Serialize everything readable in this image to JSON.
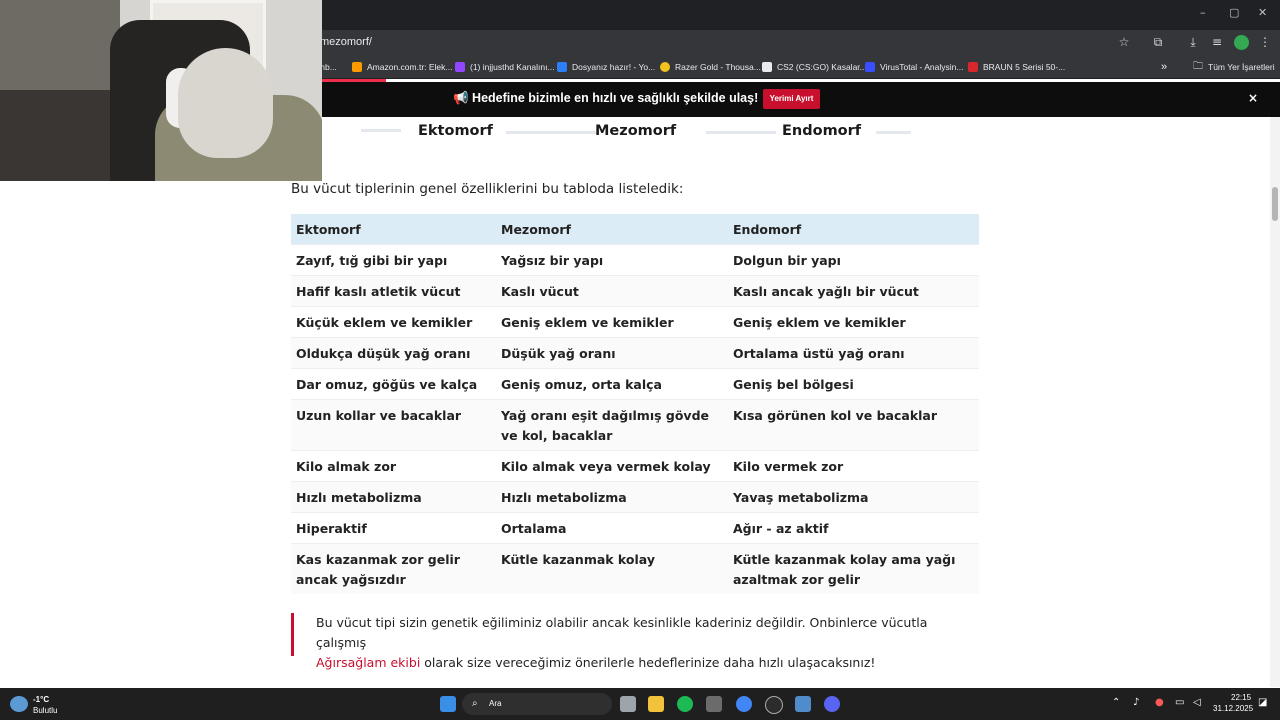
{
  "browser": {
    "url": "mezomorf/",
    "bookmarks": [
      {
        "label": "shb...",
        "color": "#f29900"
      },
      {
        "label": "Amazon.com.tr: Elek...",
        "color": "#ff9900"
      },
      {
        "label": "(1) injjusthd Kanalını...",
        "color": "#9146ff"
      },
      {
        "label": "Dosyanız hazır! - Yo...",
        "color": "#2d7ef7"
      },
      {
        "label": "Razer Gold - Thousa...",
        "color": "#f4c21b"
      },
      {
        "label": "CS2 (CS:GO) Kasalar...",
        "color": "#e8eaed"
      },
      {
        "label": "VirusTotal - Analysin...",
        "color": "#394eff"
      },
      {
        "label": "BRAUN 5 Serisi 50-...",
        "color": "#d7262c"
      }
    ],
    "all_bookmarks": "Tüm Yer İşaretleri",
    "more_bookmarks_icon": "»"
  },
  "banner": {
    "text": "📢 Hedefine bizimle en hızlı ve sağlıklı şekilde ulaş! 💪",
    "button": "Yerimi Ayırt",
    "close": "×"
  },
  "body_image": {
    "labels": [
      "Ektomorf",
      "Mezomorf",
      "Endomorf"
    ]
  },
  "article": {
    "intro": "Bu vücut tiplerinin genel özelliklerini bu tabloda listeledik:",
    "table": {
      "headers": [
        "Ektomorf",
        "Mezomorf",
        "Endomorf"
      ],
      "rows": [
        [
          "Zayıf, tığ gibi bir yapı",
          "Yağsız bir yapı",
          "Dolgun bir yapı"
        ],
        [
          "Hafif kaslı atletik vücut",
          "Kaslı vücut",
          "Kaslı ancak yağlı bir vücut"
        ],
        [
          "Küçük eklem ve kemikler",
          "Geniş eklem ve kemikler",
          "Geniş eklem ve kemikler"
        ],
        [
          "Oldukça düşük yağ oranı",
          "Düşük yağ oranı",
          "Ortalama üstü yağ oranı"
        ],
        [
          "Dar omuz, göğüs ve kalça",
          "Geniş omuz, orta kalça",
          "Geniş bel bölgesi"
        ],
        [
          "Uzun kollar ve bacaklar",
          "Yağ oranı eşit dağılmış gövde ve kol, bacaklar",
          "Kısa görünen kol ve bacaklar"
        ],
        [
          "Kilo almak zor",
          "Kilo almak veya vermek kolay",
          "Kilo vermek zor"
        ],
        [
          "Hızlı metabolizma",
          "Hızlı metabolizma",
          "Yavaş metabolizma"
        ],
        [
          "Hiperaktif",
          "Ortalama",
          "Ağır - az aktif"
        ],
        [
          "Kas kazanmak zor gelir ancak yağsızdır",
          "Kütle kazanmak kolay",
          "Kütle kazanmak kolay ama yağı azaltmak zor gelir"
        ]
      ]
    },
    "quote": {
      "part1": "Bu vücut tipi sizin genetik eğiliminiz olabilir ancak kesinlikle kaderiniz değildir. Onbinlerce vücutla çalışmış",
      "link": "Ağırsağlam ekibi",
      "part2": " olarak size vereceğimiz önerilerle hedeflerinize daha hızlı ulaşacaksınız!"
    }
  },
  "taskbar": {
    "weather_temp": "-1°C",
    "weather_desc": "Bulutlu",
    "search_placeholder": "Ara",
    "time": "22:15",
    "date": "31.12.2025"
  },
  "colors": {
    "accent": "#c8102e",
    "table_header": "#dbecf6"
  }
}
